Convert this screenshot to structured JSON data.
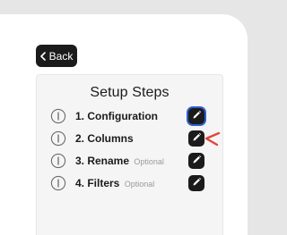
{
  "back_button": {
    "label": "Back",
    "icon": "chevron-left-icon"
  },
  "setup": {
    "title": "Setup Steps",
    "steps": [
      {
        "label": "1. Configuration",
        "optional": "",
        "info_icon": "info-icon",
        "edit_icon": "pencil-icon",
        "focused": true
      },
      {
        "label": "2. Columns",
        "optional": "",
        "info_icon": "info-icon",
        "edit_icon": "pencil-icon",
        "focused": false
      },
      {
        "label": "3. Rename",
        "optional": "Optional",
        "info_icon": "info-icon",
        "edit_icon": "pencil-icon",
        "focused": false
      },
      {
        "label": "4. Filters",
        "optional": "Optional",
        "info_icon": "info-icon",
        "edit_icon": "pencil-icon",
        "focused": false
      }
    ]
  },
  "colors": {
    "background": "#e6e6e6",
    "panel": "#f5f5f5",
    "button": "#1b1b1b",
    "focus_ring": "#2f5fd0",
    "pointer_mark": "#e0463c",
    "optional_text": "#9a9a9a"
  }
}
